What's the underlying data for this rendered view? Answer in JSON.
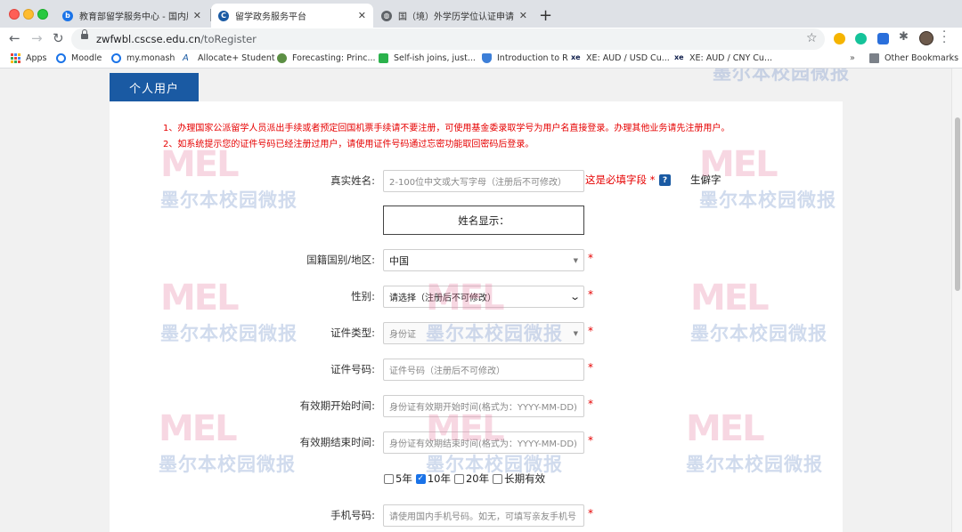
{
  "browser": {
    "tabs": [
      {
        "label": "教育部留学服务中心 - 国内版 Bi",
        "favicon_color": "#1a73e8"
      },
      {
        "label": "留学政务服务平台",
        "favicon_color": "#1a5aa3"
      },
      {
        "label": "国（境）外学历学位认证申请材料",
        "favicon_color": "#5f6368"
      }
    ],
    "url_domain": "zwfwbl.cscse.edu.cn",
    "url_path": "/toRegister",
    "bookmarks": [
      {
        "label": "Apps"
      },
      {
        "label": "Moodle"
      },
      {
        "label": "my.monash"
      },
      {
        "label": "Allocate+ Student"
      },
      {
        "label": "Forecasting: Princ..."
      },
      {
        "label": "Self-ish joins, just..."
      },
      {
        "label": "Introduction to R"
      },
      {
        "label": "XE: AUD / USD Cu..."
      },
      {
        "label": "XE: AUD / CNY Cu..."
      }
    ],
    "bookmarks_overflow": "»",
    "other_bookmarks": "Other Bookmarks"
  },
  "page": {
    "tab_label": "个人用户",
    "notices": [
      "1、办理国家公派留学人员派出手续或者预定回国机票手续请不要注册，可使用基金委录取学号为用户名直接登录。办理其他业务请先注册用户。",
      "2、如系统提示您的证件号码已经注册过用户，请使用证件号码通过忘密功能取回密码后登录。"
    ],
    "form": {
      "real_name": {
        "label": "真实姓名:",
        "placeholder": "2-100位中文或大写字母（注册后不可修改）"
      },
      "required_note": "这是必填字段 *",
      "help": "?",
      "rare_char": "生僻字",
      "name_display": "姓名显示：",
      "nationality": {
        "label": "国籍国别/地区:",
        "value": "中国"
      },
      "gender": {
        "label": "性别:",
        "value": "请选择（注册后不可修改）"
      },
      "id_type": {
        "label": "证件类型:",
        "value": "身份证"
      },
      "id_number": {
        "label": "证件号码:",
        "placeholder": "证件号码（注册后不可修改）"
      },
      "valid_start": {
        "label": "有效期开始时间:",
        "placeholder": "身份证有效期开始时间(格式为：YYYY-MM-DD)"
      },
      "valid_end": {
        "label": "有效期结束时间:",
        "placeholder": "身份证有效期结束时间(格式为：YYYY-MM-DD)"
      },
      "validity_options": [
        {
          "label": "5年",
          "checked": false
        },
        {
          "label": "10年",
          "checked": true
        },
        {
          "label": "20年",
          "checked": false
        },
        {
          "label": "长期有效",
          "checked": false
        }
      ],
      "phone": {
        "label": "手机号码:",
        "placeholder": "请使用国内手机号码。如无，可填写亲友手机号"
      },
      "required_mark": "*"
    },
    "watermark": {
      "logo": "MEL",
      "text": "墨尔本校园微报"
    }
  }
}
